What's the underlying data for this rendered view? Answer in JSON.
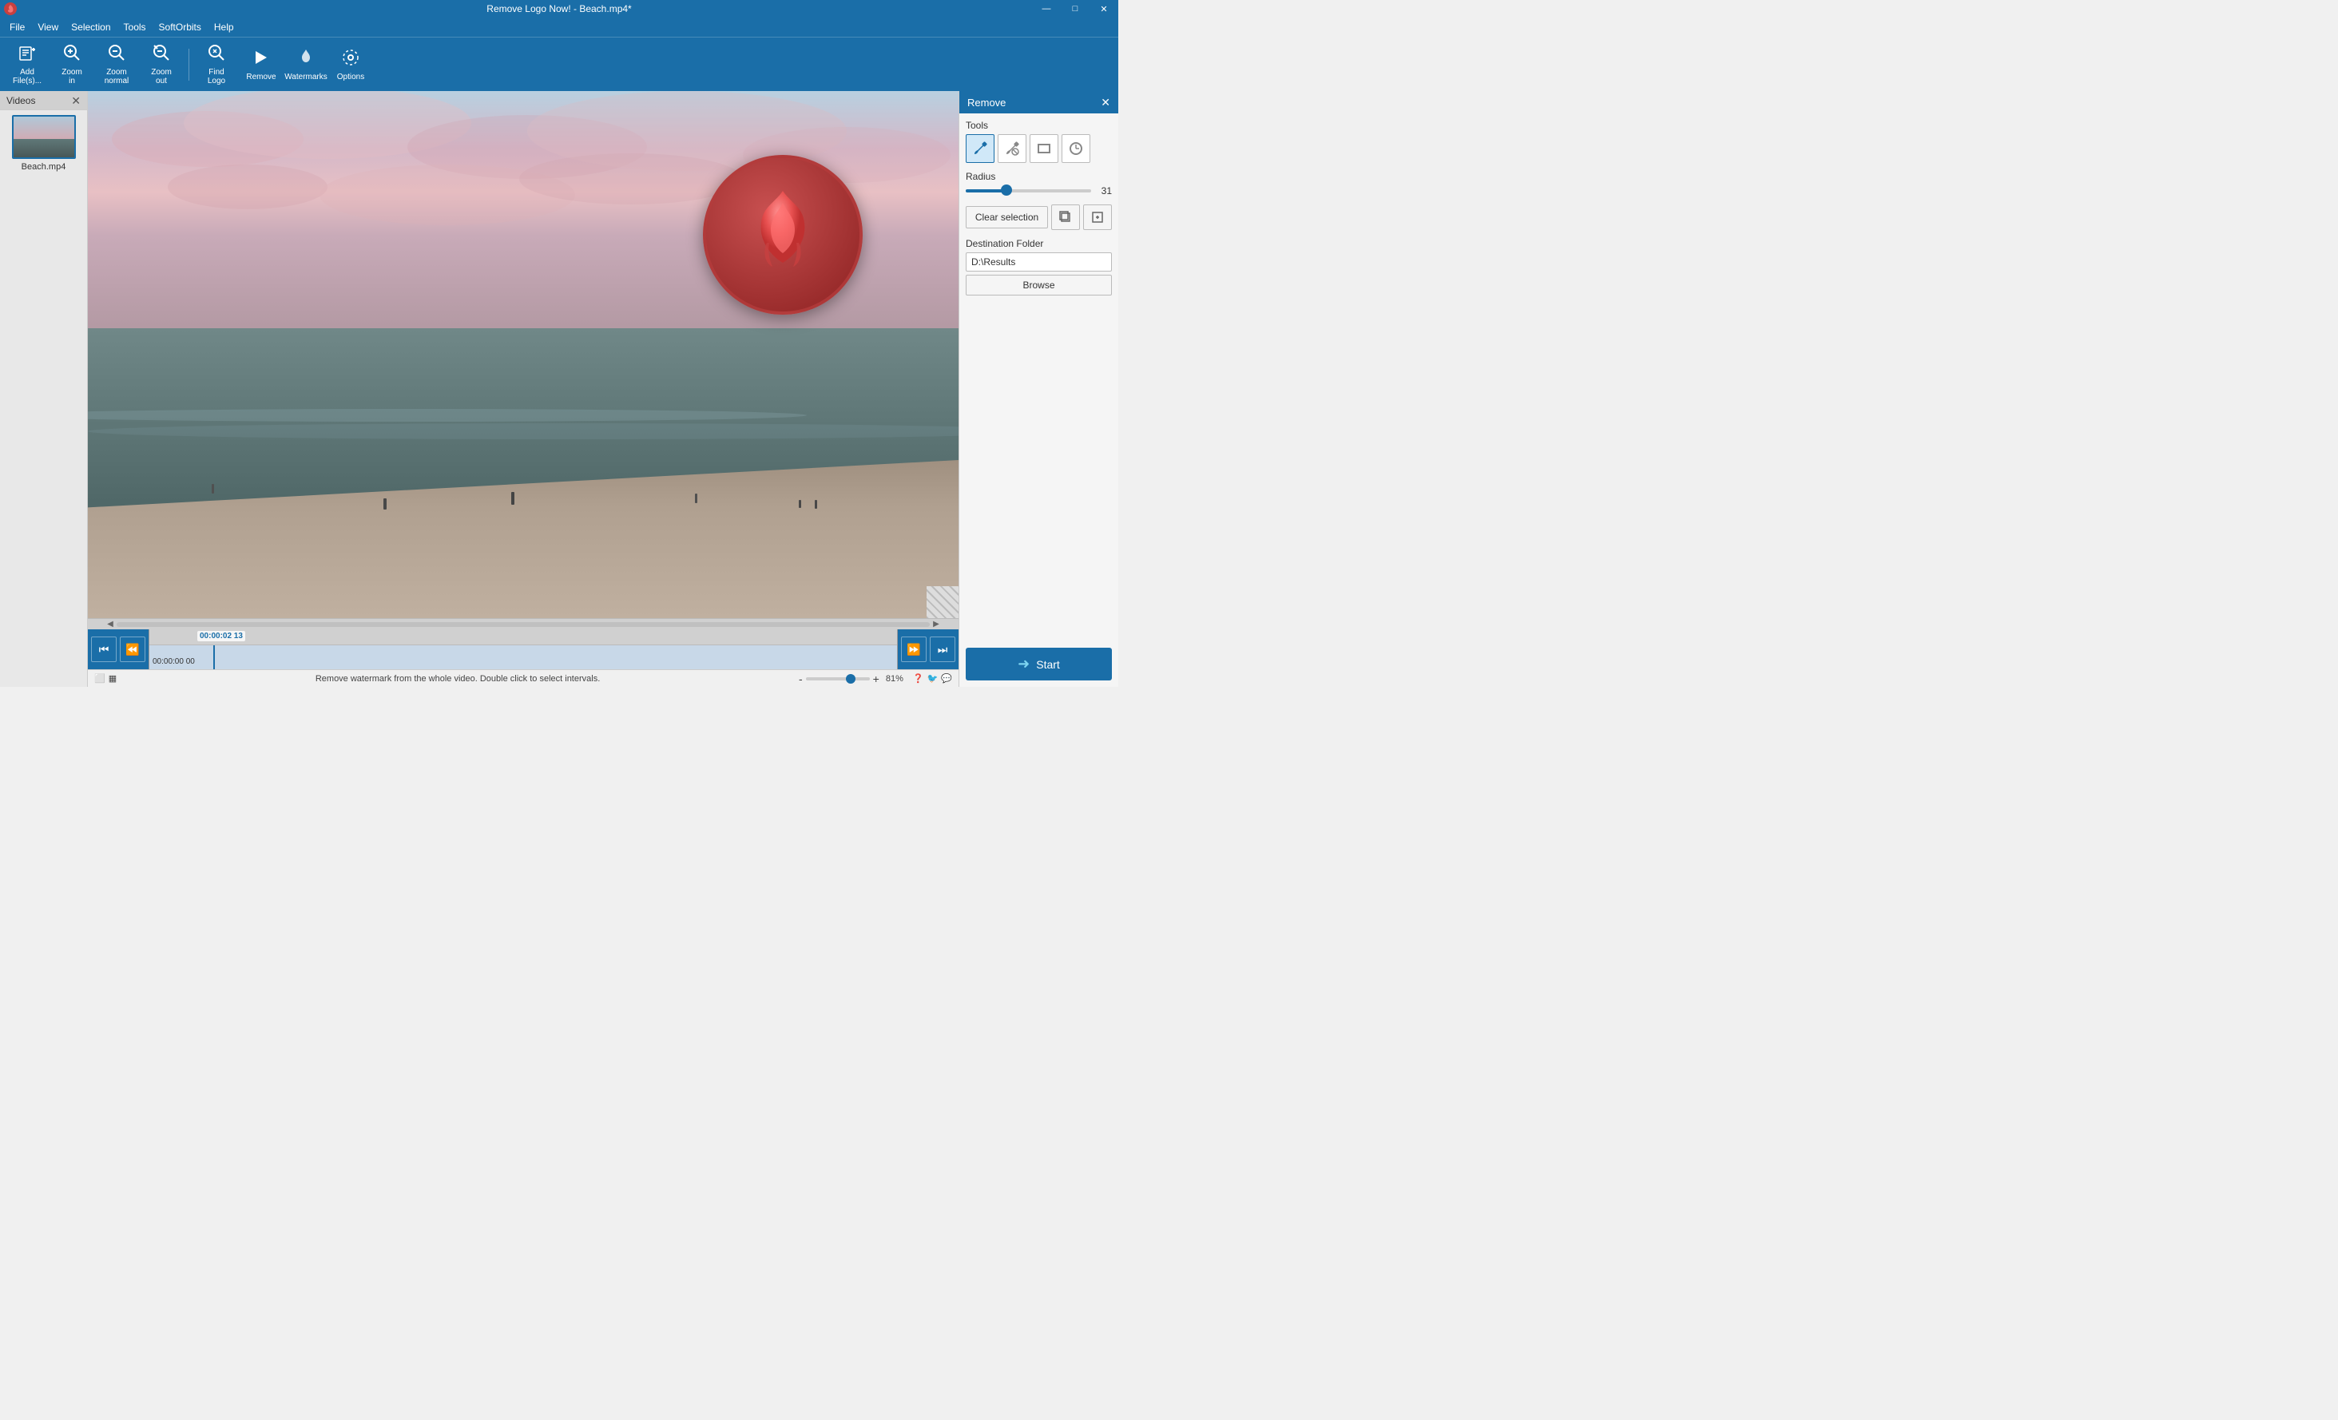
{
  "titlebar": {
    "title": "Remove Logo Now! - Beach.mp4*",
    "min_label": "—",
    "max_label": "□",
    "close_label": "✕"
  },
  "menubar": {
    "items": [
      {
        "label": "File"
      },
      {
        "label": "View"
      },
      {
        "label": "Selection"
      },
      {
        "label": "Tools"
      },
      {
        "label": "SoftOrbits"
      },
      {
        "label": "Help"
      }
    ]
  },
  "toolbar": {
    "buttons": [
      {
        "id": "add-files",
        "icon": "📁",
        "label": "Add\nFile(s)..."
      },
      {
        "id": "zoom-in",
        "icon": "🔍",
        "label": "Zoom\nin"
      },
      {
        "id": "zoom-normal",
        "icon": "🔍",
        "label": "Zoom\nnormal"
      },
      {
        "id": "zoom-out",
        "icon": "🔍",
        "label": "Zoom\nout"
      },
      {
        "id": "find-logo",
        "icon": "🔍",
        "label": "Find\nLogo"
      },
      {
        "id": "remove",
        "icon": "▶",
        "label": "Remove"
      },
      {
        "id": "watermarks",
        "icon": "💧",
        "label": "Watermarks"
      },
      {
        "id": "options",
        "icon": "⚙",
        "label": "Options"
      }
    ]
  },
  "left_panel": {
    "header": "Videos",
    "close_label": "✕",
    "files": [
      {
        "name": "Beach.mp4"
      }
    ]
  },
  "video": {
    "filename": "Beach.mp4"
  },
  "timeline": {
    "current_time": "00:00:02 13",
    "start_time": "00:00:00 00",
    "status": "Remove watermark from the whole video. Double click to select intervals."
  },
  "right_panel": {
    "title": "Remove",
    "close_label": "✕",
    "tools_label": "Tools",
    "tools": [
      {
        "id": "brush",
        "icon": "✏",
        "active": true
      },
      {
        "id": "eraser",
        "icon": "✏",
        "active": false
      },
      {
        "id": "rect",
        "icon": "▭",
        "active": false
      },
      {
        "id": "circle",
        "icon": "◯",
        "active": false
      }
    ],
    "radius_label": "Radius",
    "radius_value": "31",
    "clear_selection_label": "Clear selection",
    "copy_btns": [
      {
        "icon": "⧉"
      },
      {
        "icon": "⧉"
      }
    ],
    "destination_label": "Destination Folder",
    "destination_value": "D:\\Results",
    "browse_label": "Browse",
    "start_label": "Start"
  },
  "statusbar": {
    "status_text": "Remove watermark from the whole video. Double click to select intervals.",
    "zoom_label": "81%",
    "plus_icon": "+",
    "minus_icon": "-"
  }
}
